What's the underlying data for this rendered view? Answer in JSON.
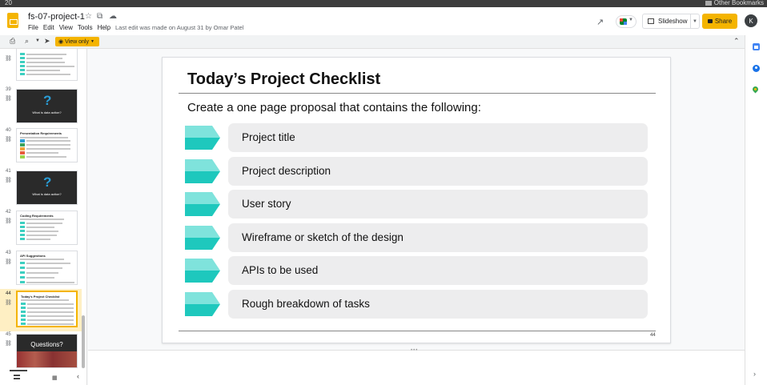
{
  "browser": {
    "tab_count": "20",
    "bookmarks_label": "Other Bookmarks"
  },
  "header": {
    "doc_title": "fs-07-project-1",
    "menu": [
      "File",
      "Edit",
      "View",
      "Tools",
      "Help"
    ],
    "last_edit": "Last edit was made on August 31 by Omar Patel",
    "slideshow_label": "Slideshow",
    "share_label": "Share",
    "avatar_letter": "K"
  },
  "toolbar": {
    "view_only_label": "View only"
  },
  "filmstrip": {
    "slides": [
      {
        "number": "",
        "kind": "list",
        "title": ""
      },
      {
        "number": "39",
        "kind": "question",
        "text": "What is data action?"
      },
      {
        "number": "40",
        "kind": "list",
        "title": "Presentation Requirements"
      },
      {
        "number": "41",
        "kind": "question",
        "text": "What is data action?"
      },
      {
        "number": "42",
        "kind": "list",
        "title": "Coding Requirements"
      },
      {
        "number": "43",
        "kind": "list",
        "title": "API Suggestions"
      },
      {
        "number": "44",
        "kind": "list",
        "title": "Today's Project Checklist",
        "selected": true
      },
      {
        "number": "45",
        "kind": "questions",
        "text": "Questions?"
      }
    ]
  },
  "slide": {
    "title": "Today’s Project Checklist",
    "subtitle": "Create a one page proposal that contains the following:",
    "items": [
      "Project title",
      "Project description",
      "User story",
      "Wireframe or sketch of the design",
      "APIs to be used",
      "Rough breakdown of tasks"
    ],
    "page_number": "44",
    "accent_light": "#7fe3dc",
    "accent_dark": "#1ec8bd"
  },
  "colors": {
    "brand_yellow": "#f4b400",
    "selected_bg": "#feefc3"
  }
}
